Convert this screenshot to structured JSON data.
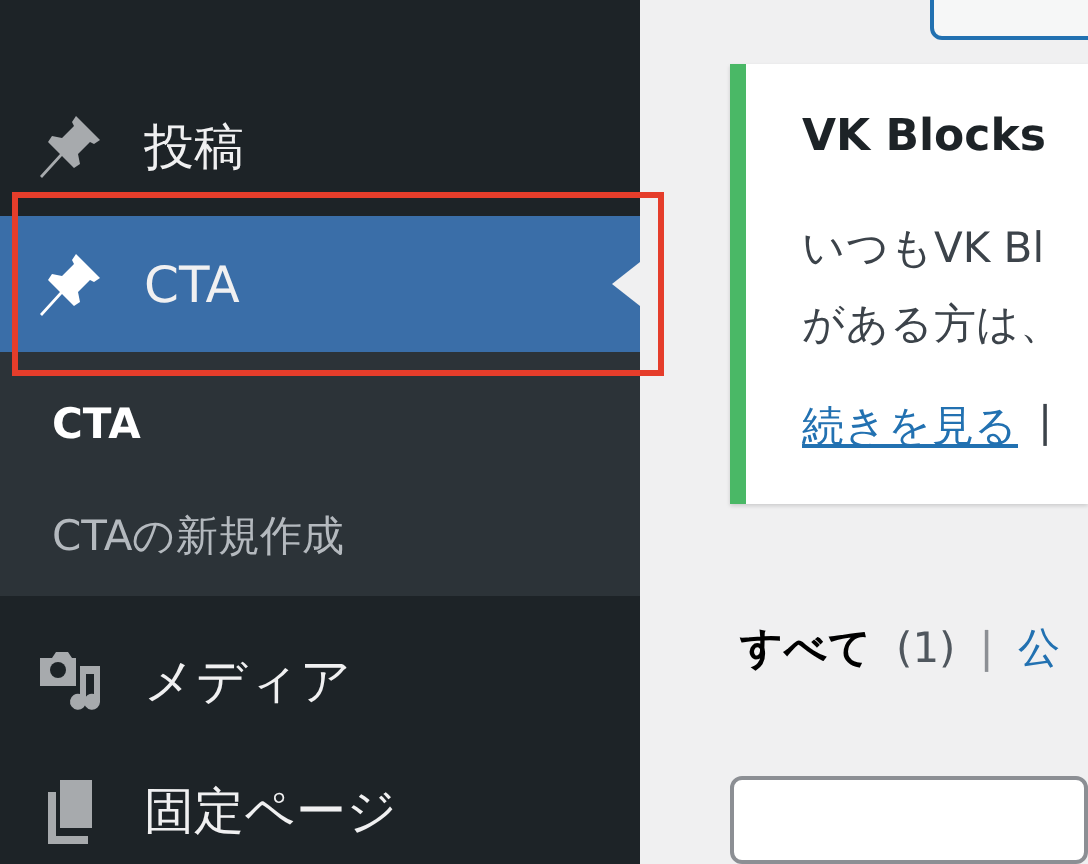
{
  "sidebar": {
    "items": [
      {
        "label": "投稿",
        "kind": "pin",
        "selected": false
      },
      {
        "label": "CTA",
        "kind": "pin",
        "selected": true,
        "children": [
          {
            "label": "CTA",
            "selected": true
          },
          {
            "label": "CTAの新規作成",
            "selected": false
          }
        ]
      },
      {
        "label": "メディア",
        "kind": "media",
        "selected": false
      },
      {
        "label": "固定ページ",
        "kind": "pages",
        "selected": false
      }
    ]
  },
  "notice": {
    "title": "VK Blocks",
    "lines": [
      "いつもVK Bl",
      "がある方は、"
    ],
    "link": "続きを見る",
    "separator": "|"
  },
  "filters": [
    {
      "label": "すべて",
      "count": "(1)",
      "selected": true
    },
    {
      "label": "公",
      "selected": false
    }
  ],
  "filter_separator": "|"
}
